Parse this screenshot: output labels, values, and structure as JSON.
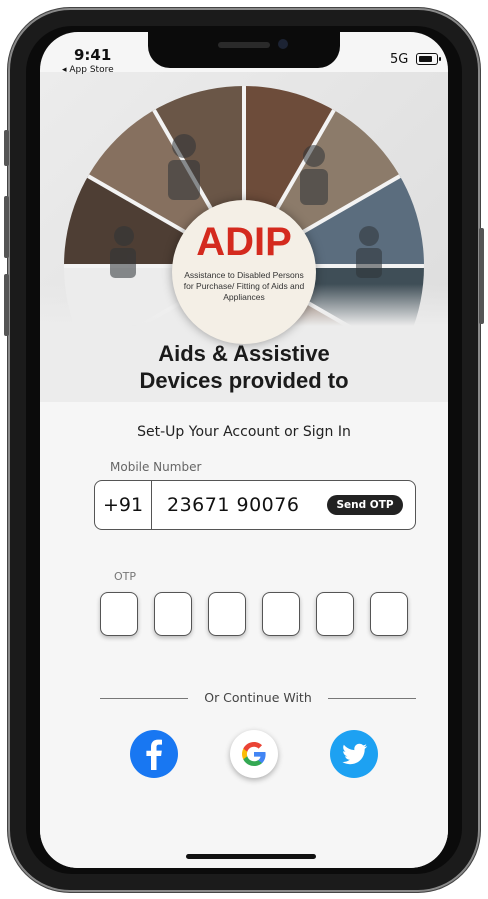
{
  "status_bar": {
    "time": "9:41",
    "back_app": "◂ App Store",
    "network": "5G"
  },
  "banner": {
    "logo_text": "ADIP",
    "logo_subtitle": "Assistance to Disabled Persons for Purchase/ Fitting of Aids and Appliances",
    "headline_line1": "Aids & Assistive",
    "headline_line2": "Devices provided to"
  },
  "form": {
    "heading": "Set-Up Your Account or Sign In",
    "mobile_label": "Mobile Number",
    "country_code": "+91",
    "mobile_value": "23671 90076",
    "send_otp_label": "Send OTP",
    "otp_label": "OTP",
    "otp_digits": [
      "",
      "",
      "",
      "",
      "",
      ""
    ],
    "divider_text": "Or Continue With"
  },
  "social": [
    {
      "name": "facebook-icon",
      "color": "#1877F2"
    },
    {
      "name": "google-icon",
      "color": "#ffffff"
    },
    {
      "name": "twitter-icon",
      "color": "#1DA1F2"
    }
  ]
}
